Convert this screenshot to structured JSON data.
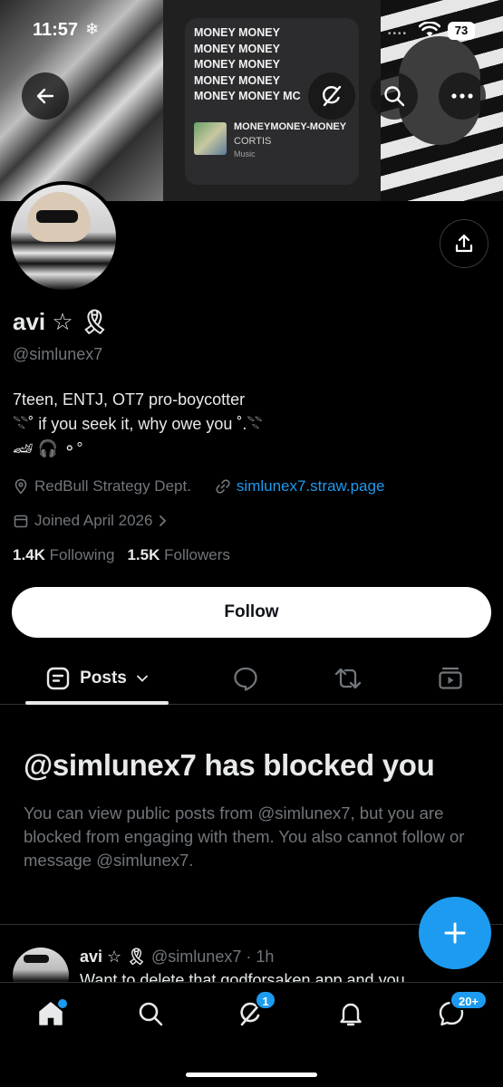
{
  "status_bar": {
    "time": "11:57",
    "weather_glyph": "❄",
    "battery": "73"
  },
  "banner": {
    "lyrics": [
      "MONEY MONEY",
      "MONEY MONEY",
      "MONEY MONEY",
      "MONEY MONEY",
      "MONEY MONEY MC"
    ],
    "track_title": "MONEYMONEY-MONEY",
    "track_artist": "CORTIS",
    "track_source": "Music"
  },
  "profile": {
    "name": "avi ☆ 🎗",
    "handle": "@simlunex7",
    "bio": "7teen, ENTJ, OT7 pro-boycotter\n𓇢˚ if you seek it, why owe you ˚.𓇢\n🏎 🎧 ⚬°",
    "location": "RedBull Strategy Dept.",
    "website": "simlunex7.straw.page",
    "joined": "Joined April 2026",
    "following_count": "1.4K",
    "following_label": "Following",
    "followers_count": "1.5K",
    "followers_label": "Followers",
    "follow_button": "Follow"
  },
  "tabs": {
    "posts_label": "Posts"
  },
  "blocked": {
    "title": "@simlunex7 has blocked you",
    "text": "You can view public posts from @simlunex7, but you are blocked from engaging with them. You also cannot follow or message @simlunex7."
  },
  "post": {
    "author": "avi ☆ 🎗",
    "meta": "@simlunex7 · 1h",
    "text": "Want to delete that godforsaken app and you"
  },
  "nav": {
    "messages_badge": "1",
    "chat_badge": "20+"
  },
  "colors": {
    "accent": "#1d9bf0",
    "muted": "#71767b",
    "text": "#e7e9ea",
    "background": "#000000"
  }
}
